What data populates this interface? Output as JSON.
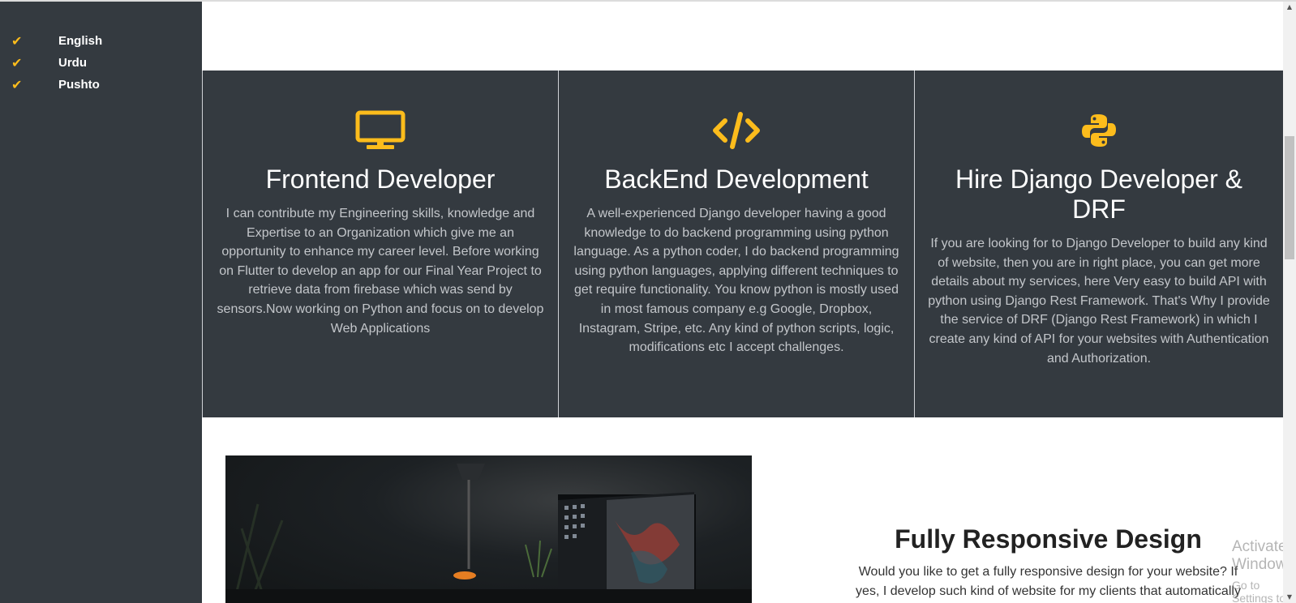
{
  "languages": [
    {
      "label": "English"
    },
    {
      "label": "Urdu"
    },
    {
      "label": "Pushto"
    }
  ],
  "check_icon": "check-icon",
  "accent_color": "#fcbc1c",
  "services": [
    {
      "icon": "monitor-icon",
      "title": "Frontend Developer",
      "text": "I can contribute my Engineering skills, knowledge and Expertise to an Organization which give me an opportunity to enhance my career level. Before working on Flutter to develop an app for our Final Year Project to retrieve data from firebase which was send by sensors.Now working on Python and focus on to develop Web Applications"
    },
    {
      "icon": "code-icon",
      "title": "BackEnd Development",
      "text": "A well-experienced Django developer having a good knowledge to do backend programming using python language. As a python coder, I do backend programming using python languages, applying different techniques to get require functionality. You know python is mostly used in most famous company e.g Google, Dropbox, Instagram, Stripe, etc. Any kind of python scripts, logic, modifications etc I accept challenges."
    },
    {
      "icon": "python-icon",
      "title": "Hire Django Developer & DRF",
      "text": "If you are looking for to Django Developer to build any kind of website, then you are in right place, you can get more details about my services, here Very easy to build API with python using Django Rest Framework. That's Why I provide the service of DRF (Django Rest Framework) in which I create any kind of API for your websites with Authentication and Authorization."
    }
  ],
  "feature": {
    "title": "Fully Responsive Design",
    "text": "Would you like to get a fully responsive design for your website? If yes, I develop such kind of website for my clients that automatically adjust to"
  },
  "watermark": {
    "line1": "Activate Windows",
    "line2": "Go to Settings to activate Windows."
  }
}
